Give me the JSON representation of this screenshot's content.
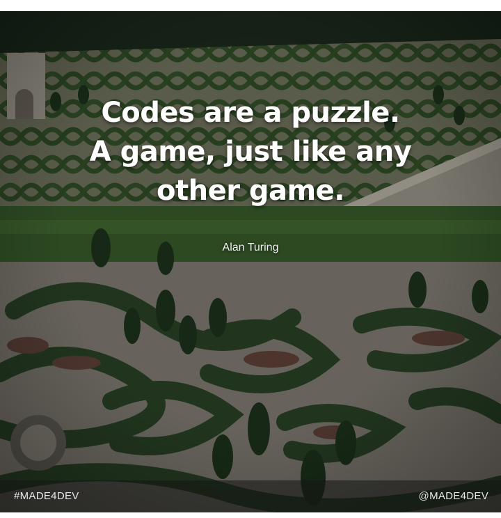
{
  "quote": {
    "line_1": "Codes are a puzzle.",
    "line_2": "A game, just like any",
    "line_3": "other game."
  },
  "author": "Alan Turing",
  "footer": {
    "hashtag": "#MADE4DEV",
    "handle": "@MADE4DEV"
  },
  "colors": {
    "hedge": "#2f4a2a",
    "path": "#8f8a80",
    "quote_text": "#ffffff",
    "overlay": "#000000"
  }
}
